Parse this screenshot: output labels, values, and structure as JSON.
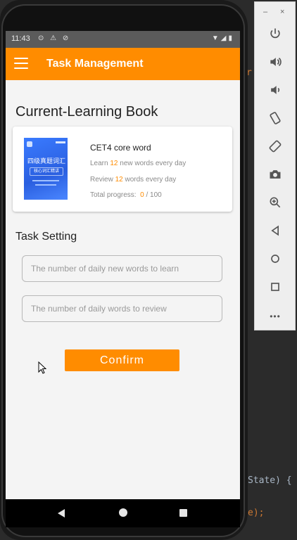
{
  "status_bar": {
    "time": "11:43",
    "icons_left": "⊙ ⚠ ⊘",
    "icons_right": "▼◢▮"
  },
  "app_bar": {
    "title": "Task Management"
  },
  "current_book": {
    "heading": "Current-Learning Book",
    "cover_title": "四级真题词汇",
    "cover_subtitle": "核心词汇精讲",
    "name": "CET4 core word",
    "learn_prefix": "Learn",
    "learn_count": "12",
    "learn_suffix": "new words every day",
    "review_prefix": "Review",
    "review_count": "12",
    "review_suffix": "words every day",
    "progress_prefix": "Total progress:",
    "progress_done": "0",
    "progress_total": "/ 100"
  },
  "task_setting": {
    "heading": "Task Setting",
    "new_words_placeholder": "The number of daily new words to learn",
    "review_words_placeholder": "The number of daily words to review",
    "confirm_label": "Confirm"
  },
  "ide": {
    "code_line1": "State) {",
    "code_line2": "e);",
    "code_fragment": "r"
  },
  "emulator_toolbar": {
    "minimize": "–",
    "close": "×",
    "more": "•••"
  },
  "colors": {
    "accent": "#ff8c00",
    "statusbar": "#5b5b5b",
    "screen_bg": "#f4f4f4"
  }
}
